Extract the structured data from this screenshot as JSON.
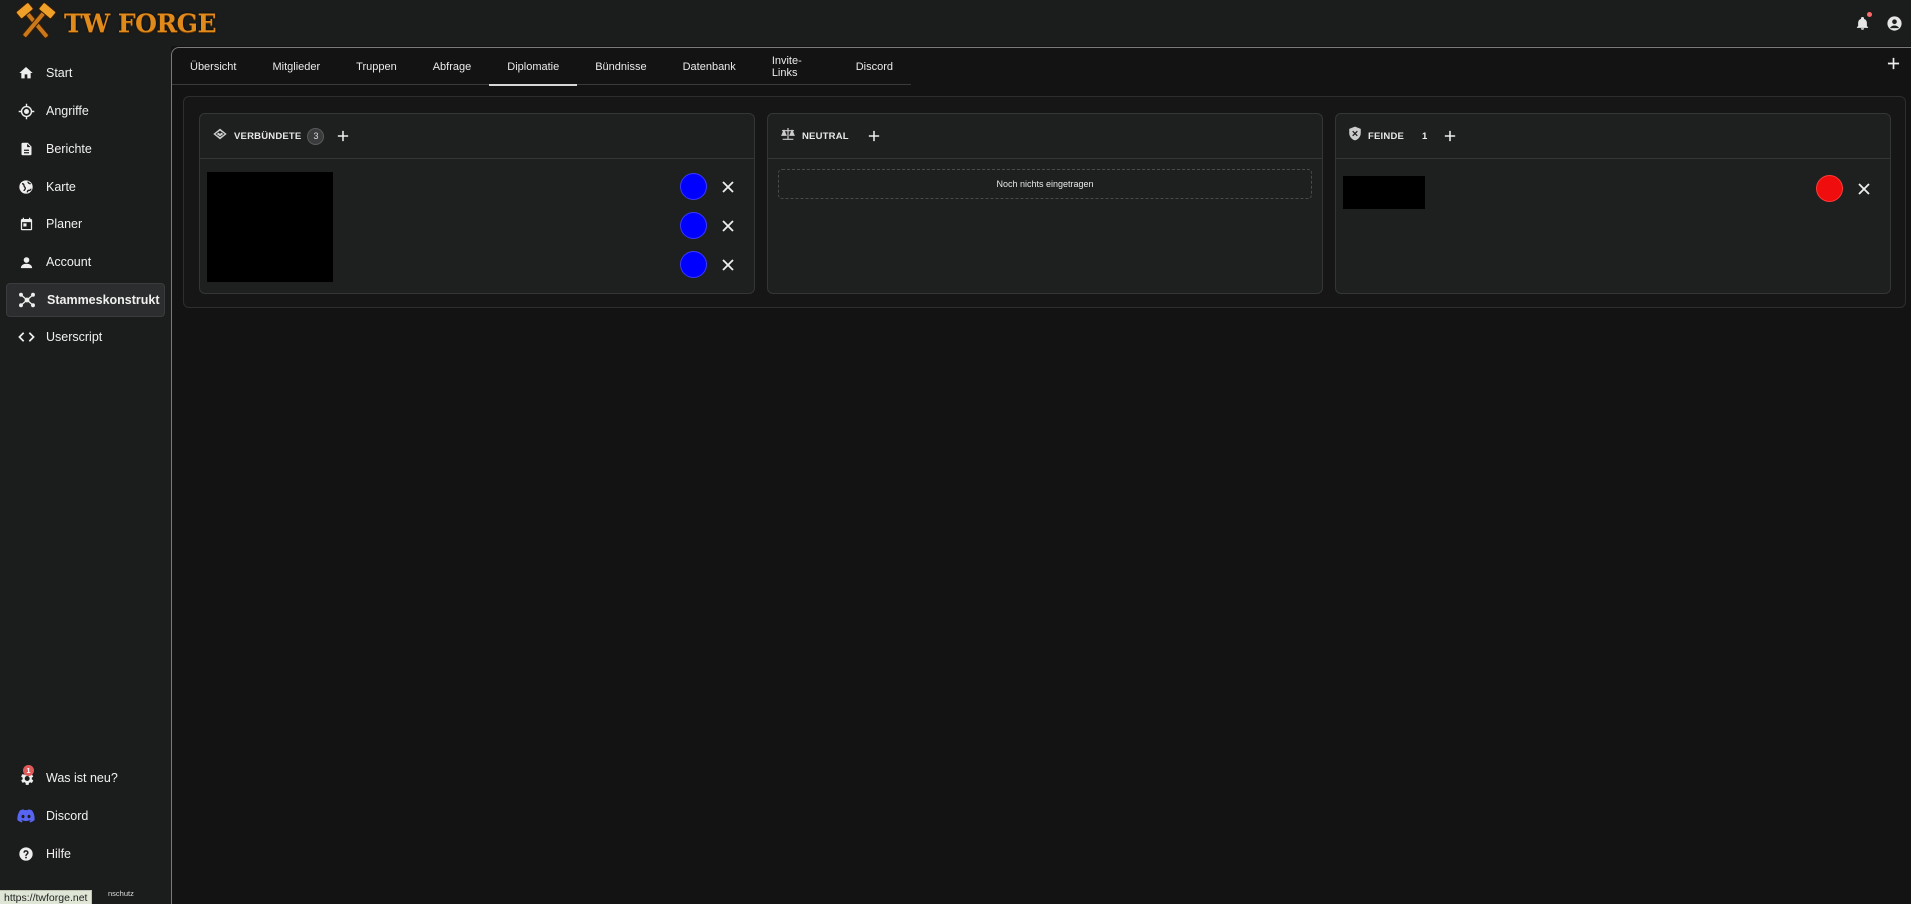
{
  "app": {
    "brand": "TW FORGE"
  },
  "colors": {
    "brand_orange": "#e08a1c",
    "ally_color": "#0000ff",
    "enemy_color": "#ef0d0d",
    "notification_dot": "#ff6b6b"
  },
  "header": {
    "icons": [
      "bell-icon",
      "account-circle-icon"
    ]
  },
  "sidebar": {
    "items": [
      {
        "label": "Start",
        "icon": "home-icon"
      },
      {
        "label": "Angriffe",
        "icon": "crosshair-icon"
      },
      {
        "label": "Berichte",
        "icon": "document-icon"
      },
      {
        "label": "Karte",
        "icon": "globe-icon"
      },
      {
        "label": "Planer",
        "icon": "calendar-icon"
      },
      {
        "label": "Account",
        "icon": "person-icon"
      },
      {
        "label": "Stammeskonstrukt",
        "icon": "network-icon",
        "active": true
      },
      {
        "label": "Userscript",
        "icon": "code-icon"
      }
    ],
    "bottom_items": [
      {
        "label": "Was ist neu?",
        "icon": "gear-badge-icon",
        "badge": "1"
      },
      {
        "label": "Discord",
        "icon": "discord-icon"
      },
      {
        "label": "Hilfe",
        "icon": "help-icon"
      }
    ],
    "footer_fragment": "nschutz"
  },
  "status_bar": {
    "url": "https://twforge.net"
  },
  "tabs": [
    {
      "label": "Übersicht"
    },
    {
      "label": "Mitglieder"
    },
    {
      "label": "Truppen"
    },
    {
      "label": "Abfrage"
    },
    {
      "label": "Diplomatie",
      "active": true
    },
    {
      "label": "Bündnisse"
    },
    {
      "label": "Datenbank"
    },
    {
      "label": "Invite-Links"
    },
    {
      "label": "Discord"
    }
  ],
  "diplomacy": {
    "allies": {
      "title": "VERBÜNDETE",
      "count": "3",
      "icon": "handshake-icon",
      "entries": [
        {
          "color": "#0000ff"
        },
        {
          "color": "#0000ff"
        },
        {
          "color": "#0000ff"
        }
      ]
    },
    "neutral": {
      "title": "NEUTRAL",
      "icon": "scale-icon",
      "empty_text": "Noch nichts eingetragen"
    },
    "enemies": {
      "title": "FEINDE",
      "count": "1",
      "icon": "shield-icon",
      "entries": [
        {
          "color": "#ef0d0d"
        }
      ]
    }
  }
}
